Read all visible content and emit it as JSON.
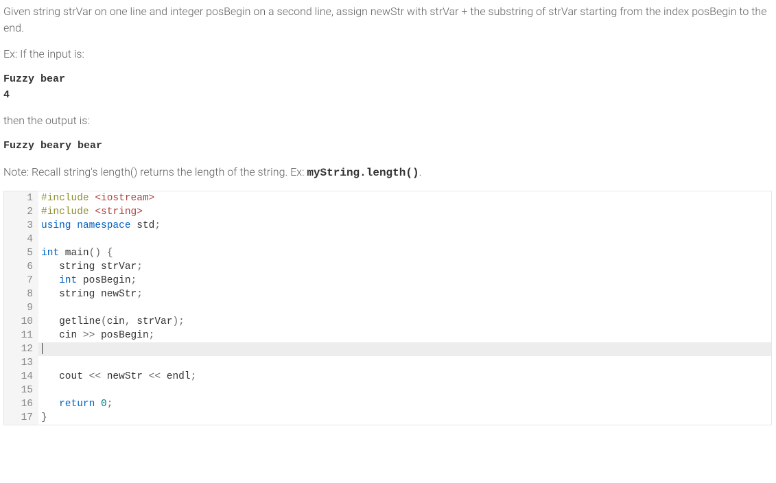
{
  "prompt": {
    "desc": "Given string strVar on one line and integer posBegin on a second line, assign newStr with strVar + the substring of strVar starting from the index posBegin to the end.",
    "ex_label": "Ex: If the input is:",
    "input1": "Fuzzy bear",
    "input2": "4",
    "then_label": "then the output is:",
    "output": "Fuzzy beary bear",
    "note_prefix": "Note: Recall string's length() returns the length of the string. Ex: ",
    "note_code": "myString.length()",
    "note_suffix": "."
  },
  "code": {
    "lines": [
      {
        "n": 1,
        "tokens": [
          {
            "c": "kw-pre",
            "t": "#include"
          },
          {
            "c": "",
            "t": " "
          },
          {
            "c": "kw-str",
            "t": "<iostream>"
          }
        ]
      },
      {
        "n": 2,
        "tokens": [
          {
            "c": "kw-pre",
            "t": "#include"
          },
          {
            "c": "",
            "t": " "
          },
          {
            "c": "kw-str",
            "t": "<string>"
          }
        ]
      },
      {
        "n": 3,
        "tokens": [
          {
            "c": "kw-blue",
            "t": "using"
          },
          {
            "c": "",
            "t": " "
          },
          {
            "c": "kw-blue",
            "t": "namespace"
          },
          {
            "c": "",
            "t": " std"
          },
          {
            "c": "kw-pun",
            "t": ";"
          }
        ]
      },
      {
        "n": 4,
        "tokens": []
      },
      {
        "n": 5,
        "tokens": [
          {
            "c": "kw-blue",
            "t": "int"
          },
          {
            "c": "",
            "t": " main"
          },
          {
            "c": "kw-pun",
            "t": "()"
          },
          {
            "c": "",
            "t": " "
          },
          {
            "c": "kw-pun",
            "t": "{"
          }
        ]
      },
      {
        "n": 6,
        "tokens": [
          {
            "c": "",
            "t": "   string strVar"
          },
          {
            "c": "kw-pun",
            "t": ";"
          }
        ]
      },
      {
        "n": 7,
        "tokens": [
          {
            "c": "",
            "t": "   "
          },
          {
            "c": "kw-blue",
            "t": "int"
          },
          {
            "c": "",
            "t": " posBegin"
          },
          {
            "c": "kw-pun",
            "t": ";"
          }
        ]
      },
      {
        "n": 8,
        "tokens": [
          {
            "c": "",
            "t": "   string newStr"
          },
          {
            "c": "kw-pun",
            "t": ";"
          }
        ]
      },
      {
        "n": 9,
        "tokens": []
      },
      {
        "n": 10,
        "tokens": [
          {
            "c": "",
            "t": "   getline"
          },
          {
            "c": "kw-pun",
            "t": "("
          },
          {
            "c": "",
            "t": "cin"
          },
          {
            "c": "kw-pun",
            "t": ","
          },
          {
            "c": "",
            "t": " strVar"
          },
          {
            "c": "kw-pun",
            "t": ");"
          }
        ]
      },
      {
        "n": 11,
        "tokens": [
          {
            "c": "",
            "t": "   cin "
          },
          {
            "c": "kw-pun",
            "t": ">>"
          },
          {
            "c": "",
            "t": " posBegin"
          },
          {
            "c": "kw-pun",
            "t": ";"
          }
        ]
      },
      {
        "n": 12,
        "tokens": [],
        "highlight": true,
        "cursor": true
      },
      {
        "n": 13,
        "tokens": []
      },
      {
        "n": 14,
        "tokens": [
          {
            "c": "",
            "t": "   cout "
          },
          {
            "c": "kw-pun",
            "t": "<<"
          },
          {
            "c": "",
            "t": " newStr "
          },
          {
            "c": "kw-pun",
            "t": "<<"
          },
          {
            "c": "",
            "t": " endl"
          },
          {
            "c": "kw-pun",
            "t": ";"
          }
        ]
      },
      {
        "n": 15,
        "tokens": []
      },
      {
        "n": 16,
        "tokens": [
          {
            "c": "",
            "t": "   "
          },
          {
            "c": "kw-blue",
            "t": "return"
          },
          {
            "c": "",
            "t": " "
          },
          {
            "c": "kw-num",
            "t": "0"
          },
          {
            "c": "kw-pun",
            "t": ";"
          }
        ]
      },
      {
        "n": 17,
        "tokens": [
          {
            "c": "kw-pun",
            "t": "}"
          }
        ]
      }
    ]
  }
}
